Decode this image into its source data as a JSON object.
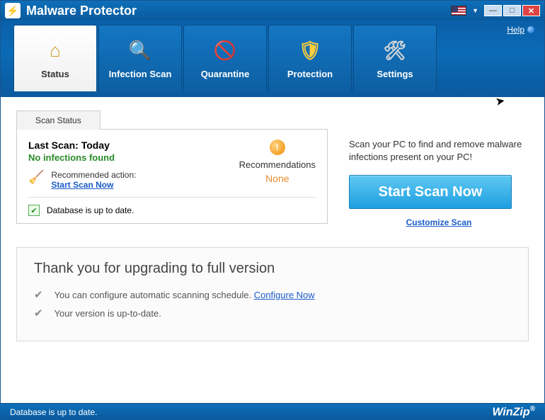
{
  "app": {
    "title": "Malware Protector",
    "help": "Help"
  },
  "tabs": {
    "status": "Status",
    "scan": "Infection Scan",
    "quarantine": "Quarantine",
    "protection": "Protection",
    "settings": "Settings"
  },
  "panel": {
    "tab_label": "Scan Status",
    "last_scan_label": "Last Scan:",
    "last_scan_value": "Today",
    "infection_status": "No infections found",
    "recommended_action_label": "Recommended action:",
    "recommended_action_link": "Start Scan Now",
    "recommendations_label": "Recommendations",
    "recommendations_value": "None",
    "database_status": "Database is up to date."
  },
  "right": {
    "promo": "Scan your PC to find and remove malware infections present on your PC!",
    "start_button": "Start Scan Now",
    "customize": "Customize Scan"
  },
  "upgrade": {
    "title": "Thank you for upgrading to full version",
    "line1_prefix": "You can configure automatic scanning schedule. ",
    "line1_link": "Configure Now",
    "line2": "Your version is up-to-date."
  },
  "statusbar": {
    "text": "Database is up to date.",
    "brand": "WinZip",
    "reg": "®"
  }
}
